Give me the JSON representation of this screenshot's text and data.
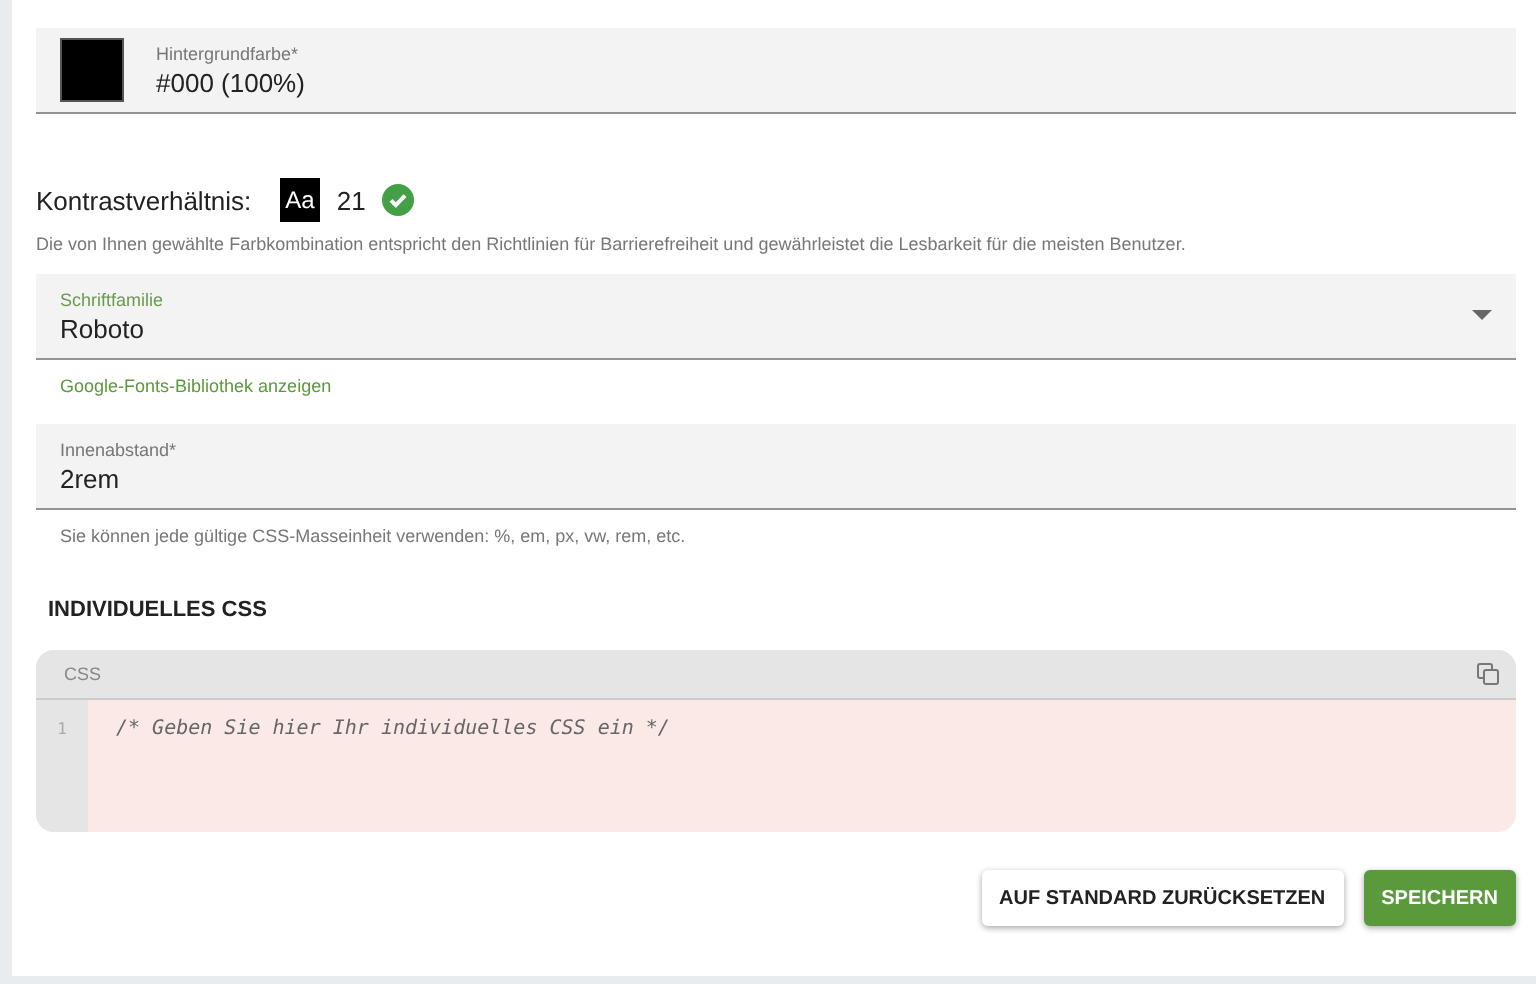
{
  "color_field": {
    "label": "Hintergrundfarbe*",
    "value": "#000 (100%)"
  },
  "contrast": {
    "label": "Kontrastverhältnis:",
    "sample": "Aa",
    "ratio": "21",
    "passed": true,
    "description": "Die von Ihnen gewählte Farbkombination entspricht den Richtlinien für Barrierefreiheit und gewährleistet die Lesbarkeit für die meisten Benutzer."
  },
  "font_field": {
    "label": "Schriftfamilie",
    "value": "Roboto",
    "link": "Google-Fonts-Bibliothek anzeigen"
  },
  "padding_field": {
    "label": "Innenabstand*",
    "value": "2rem",
    "hint": "Sie können jede gültige CSS-Masseinheit verwenden: %, em, px, vw, rem, etc."
  },
  "custom_css": {
    "heading": "INDIVIDUELLES CSS",
    "editor_label": "CSS",
    "line_numbers": [
      "1"
    ],
    "placeholder": "/* Geben Sie hier Ihr individuelles CSS ein */"
  },
  "buttons": [
    {
      "label": "AUF STANDARD ZURÜCKSETZEN",
      "kind": "secondary"
    },
    {
      "label": "SPEICHERN",
      "kind": "primary"
    }
  ]
}
